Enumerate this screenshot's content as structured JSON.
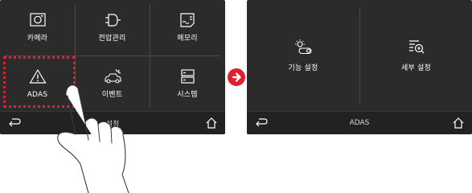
{
  "menu_screen": {
    "items": [
      {
        "label": "카메라",
        "icon": "camera-icon"
      },
      {
        "label": "전압관리",
        "icon": "power-plug-icon"
      },
      {
        "label": "메모리",
        "icon": "memory-card-icon"
      },
      {
        "label": "ADAS",
        "icon": "warning-triangle-icon"
      },
      {
        "label": "이벤트",
        "icon": "car-collision-icon"
      },
      {
        "label": "시스템",
        "icon": "server-system-icon"
      }
    ],
    "bottom_bar": {
      "title": "설정"
    }
  },
  "adas_screen": {
    "items": [
      {
        "label": "기능 설정",
        "icon": "function-toggle-icon"
      },
      {
        "label": "세부 설정",
        "icon": "detail-search-icon"
      }
    ],
    "bottom_bar": {
      "title": "ADAS"
    }
  },
  "colors": {
    "screen_bg": "#2b2b2b",
    "highlight": "#e0202e",
    "arrow": "#e0202e",
    "text": "#ffffff"
  }
}
